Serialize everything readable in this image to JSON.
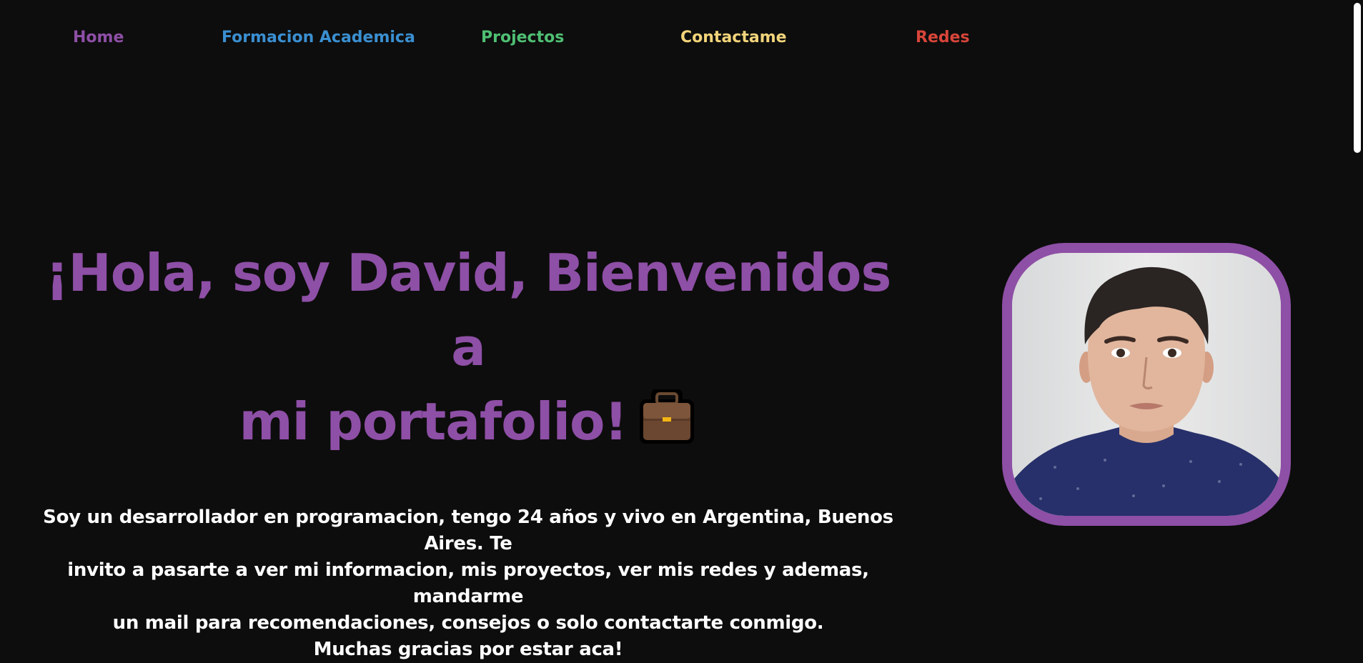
{
  "nav": {
    "items": [
      {
        "label": "Home",
        "color": "#8e4fa6"
      },
      {
        "label": "Formacion Academica",
        "color": "#3a8fd1"
      },
      {
        "label": "Projectos",
        "color": "#4fbf73"
      },
      {
        "label": "Contactame",
        "color": "#f2d47a"
      },
      {
        "label": "Redes",
        "color": "#d9453a"
      }
    ]
  },
  "hero": {
    "title_line1": "¡Hola, soy David, Bienvenidos a",
    "title_line2": "mi portafolio!",
    "title_icon": "briefcase-icon",
    "title_color": "#8e4fa6",
    "paragraph_lines": [
      "Soy un desarrollador en programacion, tengo 24 años y vivo en Argentina, Buenos Aires. Te",
      "invito a pasarte a ver mi informacion, mis proyectos, ver mis redes y ademas, mandarme",
      "un mail para recomendaciones, consejos o solo contactarte conmigo.",
      "Muchas gracias por estar aca!"
    ]
  },
  "profile_photo": {
    "border_color": "#8e4fa6"
  },
  "colors": {
    "background": "#0d0d0d",
    "text": "#ffffff"
  }
}
